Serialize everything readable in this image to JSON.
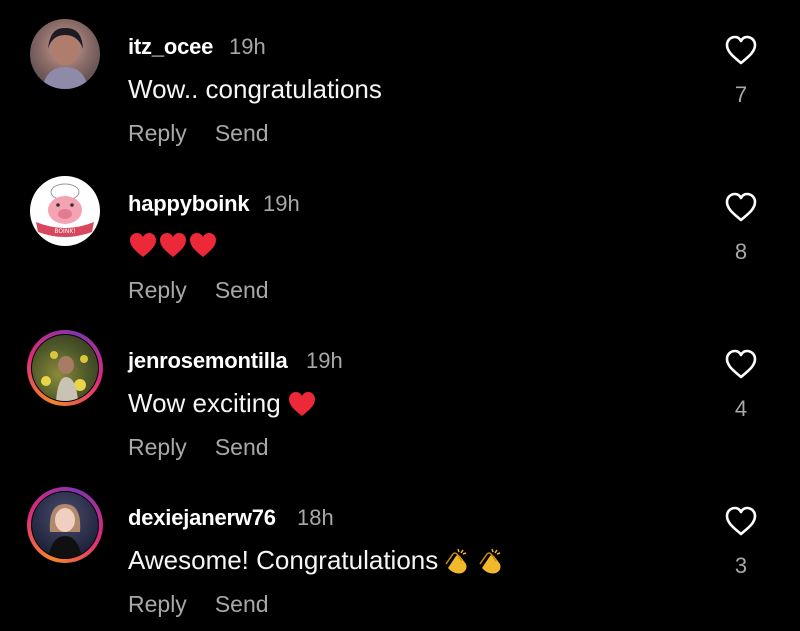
{
  "comments": [
    {
      "username": "itz_ocee",
      "time": "19h",
      "text": "Wow.. congratulations",
      "emojis": [],
      "like_count": "7",
      "reply": "Reply",
      "send": "Send",
      "has_story_ring": false
    },
    {
      "username": "happyboink",
      "time": "19h",
      "text": "",
      "emojis": [
        "red-heart",
        "red-heart",
        "red-heart"
      ],
      "like_count": "8",
      "reply": "Reply",
      "send": "Send",
      "has_story_ring": false,
      "avatar_badge": "BOINK!"
    },
    {
      "username": "jenrosemontilla",
      "time": "19h",
      "text": "Wow exciting",
      "emojis": [
        "red-heart"
      ],
      "like_count": "4",
      "reply": "Reply",
      "send": "Send",
      "has_story_ring": true
    },
    {
      "username": "dexiejanerw76",
      "time": "18h",
      "text": "Awesome! Congratulations",
      "emojis": [
        "clapping-hands",
        "clapping-hands"
      ],
      "like_count": "3",
      "reply": "Reply",
      "send": "Send",
      "has_story_ring": true
    }
  ],
  "colors": {
    "background": "#000000",
    "primary_text": "#ffffff",
    "secondary_text": "#a8a8a8",
    "heart_red": "#ed2939"
  }
}
